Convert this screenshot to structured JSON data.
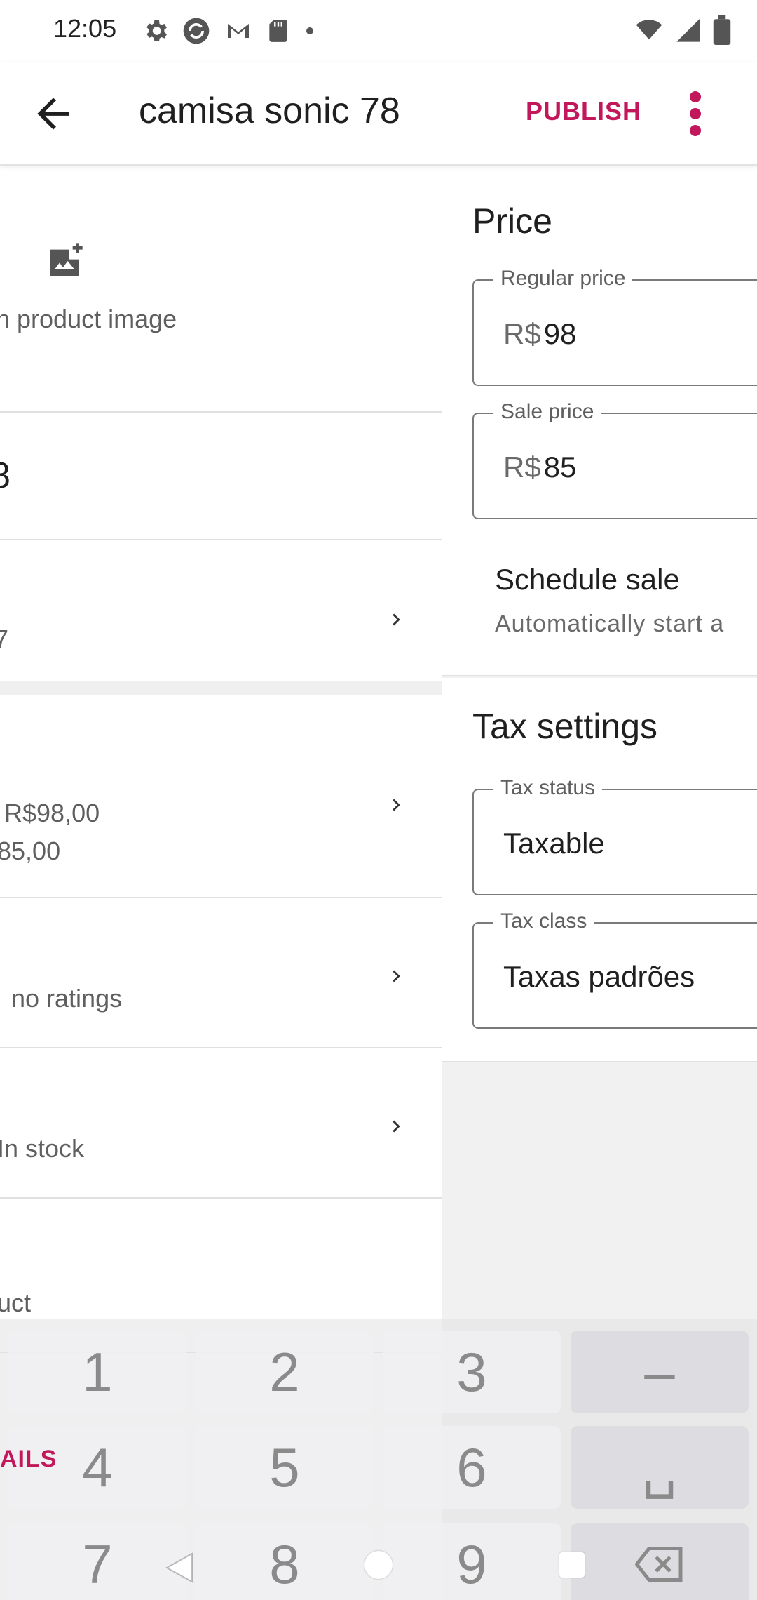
{
  "status_bar": {
    "time": "12:05"
  },
  "app_bar": {
    "title": "camisa sonic 78",
    "publish_label": "PUBLISH"
  },
  "left_pane": {
    "image_label": "n product image",
    "name_partial": "8",
    "category_partial": "7",
    "price_line1": "R$98,00",
    "price_line2": "85,00",
    "reviews_text": "no ratings",
    "inventory_text": "In stock",
    "description_partial": "uct",
    "details_tab": "AILS"
  },
  "price_section": {
    "heading": "Price",
    "regular": {
      "label": "Regular price",
      "prefix": "R$",
      "value": "98"
    },
    "sale": {
      "label": "Sale price",
      "prefix": "R$",
      "value": "85"
    },
    "schedule_title": "Schedule sale",
    "schedule_subtitle": "Automatically start a"
  },
  "tax_section": {
    "heading": "Tax settings",
    "status": {
      "label": "Tax status",
      "value": "Taxable"
    },
    "class": {
      "label": "Tax class",
      "value": "Taxas padrões"
    }
  },
  "keyboard": {
    "keys": [
      "1",
      "2",
      "3",
      "–",
      "4",
      "5",
      "6",
      "␣",
      "7",
      "8",
      "9"
    ]
  }
}
